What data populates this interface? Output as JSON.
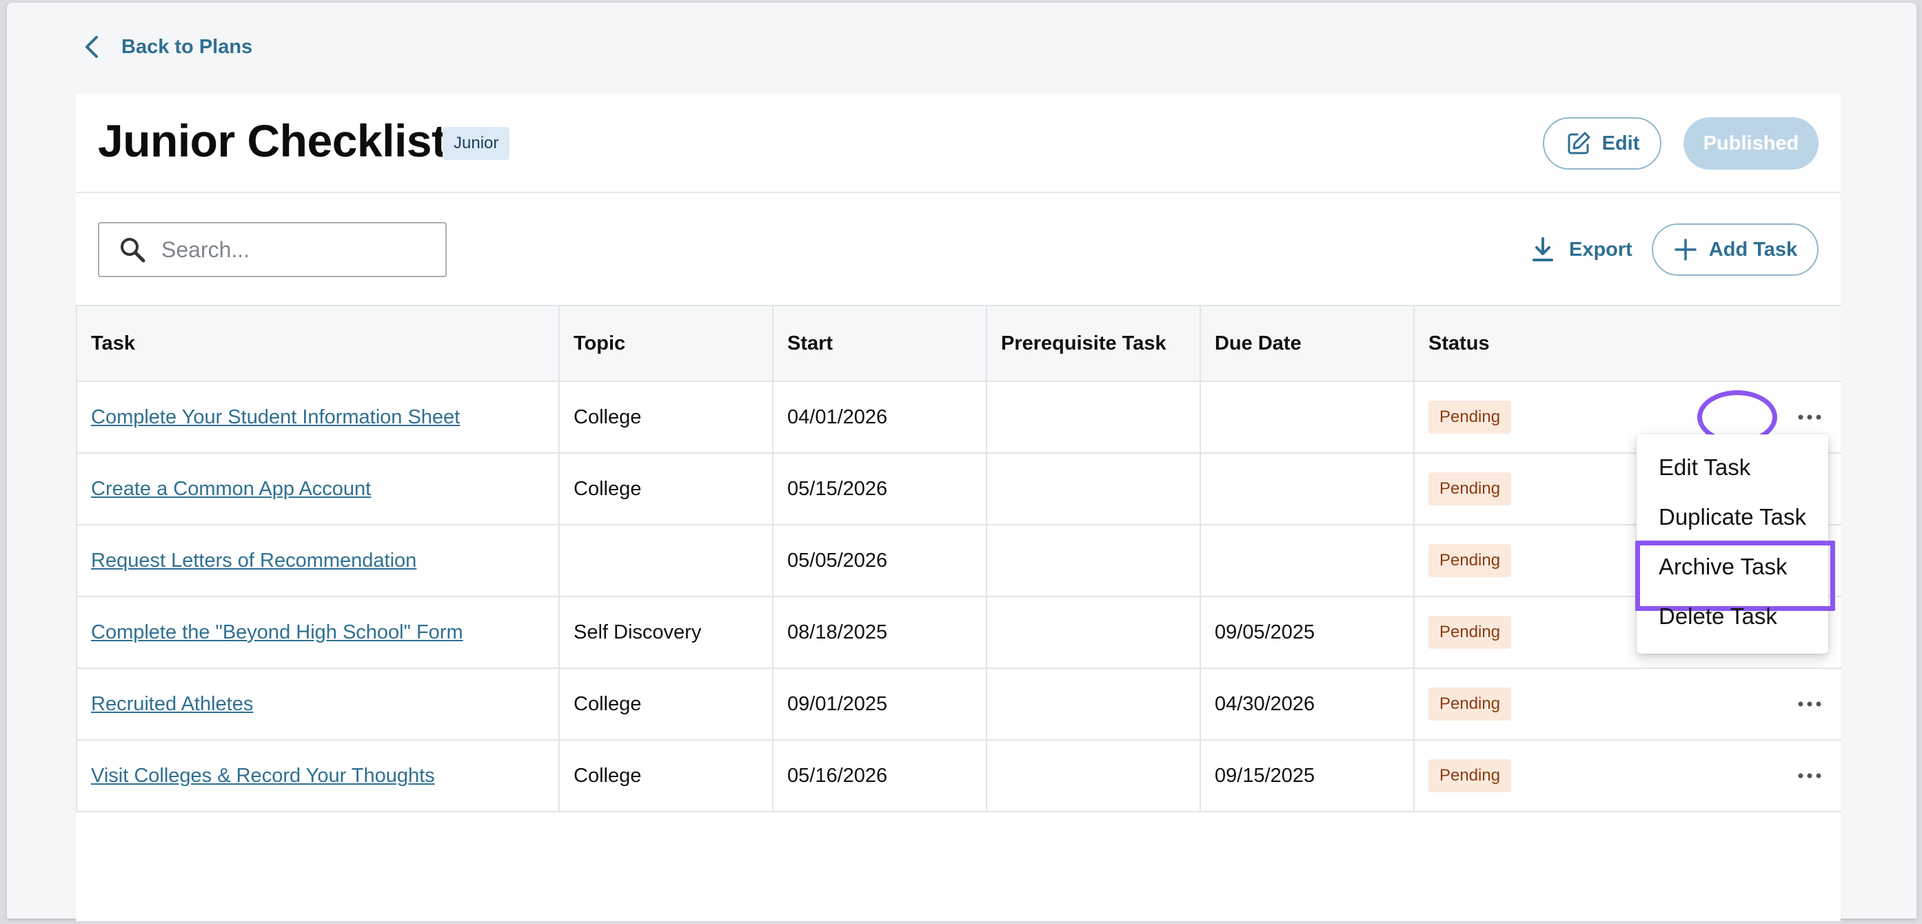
{
  "nav": {
    "back_label": "Back to Plans"
  },
  "header": {
    "title": "Junior Checklist",
    "grade_badge": "Junior",
    "edit_label": "Edit",
    "published_label": "Published"
  },
  "toolbar": {
    "search_placeholder": "Search...",
    "export_label": "Export",
    "add_task_label": "Add Task"
  },
  "table": {
    "columns": [
      "Task",
      "Topic",
      "Start",
      "Prerequisite Task",
      "Due Date",
      "Status"
    ],
    "rows": [
      {
        "task": "Complete Your Student Information Sheet",
        "topic": "College",
        "start": "04/01/2026",
        "prereq": "",
        "due": "",
        "status": "Pending"
      },
      {
        "task": "Create a Common App Account",
        "topic": "College",
        "start": "05/15/2026",
        "prereq": "",
        "due": "",
        "status": "Pending"
      },
      {
        "task": "Request Letters of Recommendation",
        "topic": "",
        "start": "05/05/2026",
        "prereq": "",
        "due": "",
        "status": "Pending"
      },
      {
        "task": "Complete the \"Beyond High School\" Form",
        "topic": "Self Discovery",
        "start": "08/18/2025",
        "prereq": "",
        "due": "09/05/2025",
        "status": "Pending"
      },
      {
        "task": "Recruited Athletes",
        "topic": "College",
        "start": "09/01/2025",
        "prereq": "",
        "due": "04/30/2026",
        "status": "Pending"
      },
      {
        "task": "Visit Colleges & Record Your Thoughts",
        "topic": "College",
        "start": "05/16/2026",
        "prereq": "",
        "due": "09/15/2025",
        "status": "Pending"
      }
    ]
  },
  "row_menu": {
    "items": [
      "Edit Task",
      "Duplicate Task",
      "Archive Task",
      "Delete Task"
    ],
    "highlighted": "Archive Task"
  },
  "colors": {
    "accent": "#2f6f92",
    "highlight": "#8a56f0",
    "pending_bg": "#fbe9dc",
    "pending_text": "#8a3c12",
    "badge_bg": "#dceaf6"
  }
}
